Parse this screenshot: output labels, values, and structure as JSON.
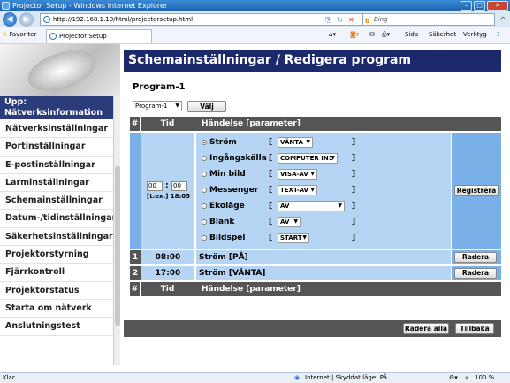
{
  "window": {
    "title": "Projector Setup - Windows Internet Explorer"
  },
  "browser": {
    "url": "http://192.168.1.10/html/projectorsetup.html",
    "search_placeholder": "Bing",
    "favorites_label": "Favoriter",
    "tab_title": "Projector Setup",
    "tools": [
      "Sida",
      "Säkerhet",
      "Verktyg"
    ]
  },
  "sidebar": {
    "heading": "Upp: Nätverksinformation",
    "items": [
      "Nätverksinställningar",
      "Portinställningar",
      "E-postinställningar",
      "Larminställningar",
      "Schemainställningar",
      "Datum-/tidinställningar",
      "Säkerhetsinställningar",
      "Projektorstyrning",
      "Fjärrkontroll",
      "Projektorstatus",
      "Starta om nätverk",
      "Anslutningstest"
    ]
  },
  "page": {
    "title": "Schemainställningar / Redigera program",
    "program_heading": "Program-1",
    "program_select": "Program-1",
    "select_button": "Välj"
  },
  "table": {
    "headers": {
      "num": "#",
      "time": "Tid",
      "event": "Händelse [parameter]"
    },
    "edit": {
      "hour": "00",
      "minute": "00",
      "separator": ":",
      "example": "[t.ex.] 18:05",
      "register_button": "Registrera",
      "events": [
        {
          "label": "Ström",
          "value": "VÄNTA",
          "selected": true
        },
        {
          "label": "Ingångskälla",
          "value": "COMPUTER IN1",
          "selected": false
        },
        {
          "label": "Min bild",
          "value": "VISA-AV",
          "selected": false
        },
        {
          "label": "Messenger",
          "value": "TEXT-AV",
          "selected": false
        },
        {
          "label": "Ekoläge",
          "value": "AV",
          "selected": false
        },
        {
          "label": "Blank",
          "value": "AV",
          "selected": false
        },
        {
          "label": "Bildspel",
          "value": "START",
          "selected": false
        }
      ]
    },
    "rows": [
      {
        "num": "1",
        "time": "08:00",
        "event": "Ström [PÅ]",
        "action": "Radera"
      },
      {
        "num": "2",
        "time": "17:00",
        "event": "Ström [VÄNTA]",
        "action": "Radera"
      }
    ]
  },
  "footer": {
    "delete_all": "Radera alla",
    "back": "Tillbaka"
  },
  "status": {
    "left": "Klar",
    "zone": "Internet | Skyddat läge: På",
    "zoom": "100 %"
  }
}
